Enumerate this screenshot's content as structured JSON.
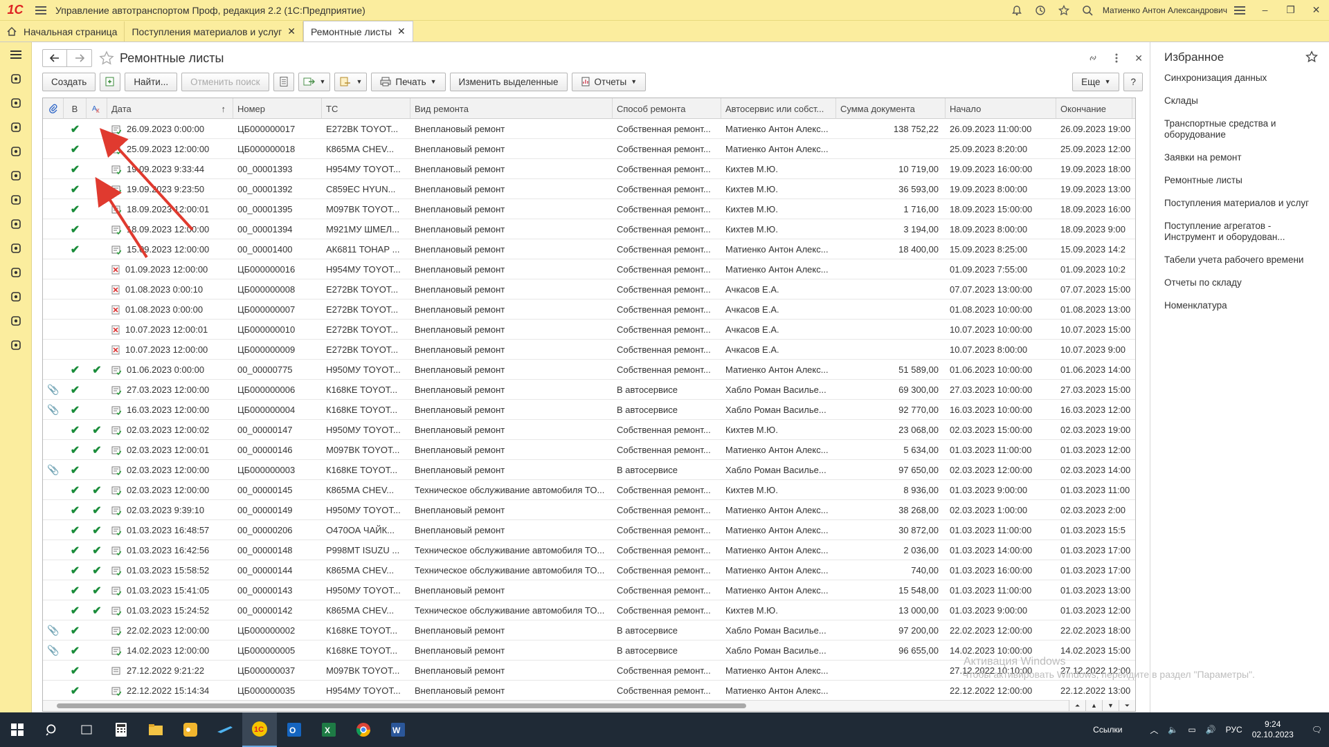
{
  "app": {
    "logo_text": "1С",
    "title": "Управление автотранспортом Проф, редакция 2.2  (1С:Предприятие)",
    "user": "Матиенко Антон Александрович"
  },
  "tabs": [
    {
      "label": "Начальная страница",
      "active": false,
      "closable": false
    },
    {
      "label": "Поступления материалов и услуг",
      "active": false,
      "closable": true
    },
    {
      "label": "Ремонтные листы",
      "active": true,
      "closable": true
    }
  ],
  "sidebar_icons": [
    "menu-icon",
    "wrench-icon",
    "truck-icon",
    "warehouse-icon",
    "employees-icon",
    "fuel-icon",
    "calculator-icon",
    "repair-icon",
    "tire-icon",
    "finance-icon",
    "reports-icon",
    "documents-icon",
    "settings-icon"
  ],
  "form": {
    "title": "Ремонтные листы"
  },
  "toolbar": {
    "create": "Создать",
    "find": "Найти...",
    "cancel_search": "Отменить поиск",
    "print": "Печать",
    "change_selected": "Изменить выделенные",
    "reports": "Отчеты",
    "more": "Еще",
    "help": "?"
  },
  "grid": {
    "headers": {
      "v": "В",
      "date": "Дата",
      "number": "Номер",
      "ts": "ТС",
      "repair_type": "Вид ремонта",
      "repair_method": "Способ ремонта",
      "autoservice": "Автосервис или собст...",
      "amount": "Сумма документа",
      "start": "Начало",
      "end": "Окончание"
    },
    "rows": [
      {
        "clip": "",
        "v": "✔",
        "b": "",
        "date": "26.09.2023 0:00:00",
        "num": "ЦБ000000017",
        "ts": "Е272ВК TOYOT...",
        "type": "Внеплановый ремонт",
        "method": "Собственная ремонт...",
        "service": "Матиенко Антон Алекс...",
        "amount": "138 752,22",
        "start": "26.09.2023 11:00:00",
        "end": "26.09.2023 19:00",
        "status": "posted"
      },
      {
        "clip": "",
        "v": "✔",
        "b": "",
        "date": "25.09.2023 12:00:00",
        "num": "ЦБ000000018",
        "ts": "К865МА CHEV...",
        "type": "Внеплановый ремонт",
        "method": "Собственная ремонт...",
        "service": "Матиенко Антон Алекс...",
        "amount": "",
        "start": "25.09.2023 8:20:00",
        "end": "25.09.2023 12:00",
        "status": "posted"
      },
      {
        "clip": "",
        "v": "✔",
        "b": "",
        "date": "19.09.2023 9:33:44",
        "num": "00_00001393",
        "ts": "Н954МУ TOYOT...",
        "type": "Внеплановый ремонт",
        "method": "Собственная ремонт...",
        "service": "Кихтев М.Ю.",
        "amount": "10 719,00",
        "start": "19.09.2023 16:00:00",
        "end": "19.09.2023 18:00",
        "status": "posted"
      },
      {
        "clip": "",
        "v": "✔",
        "b": "",
        "date": "19.09.2023 9:23:50",
        "num": "00_00001392",
        "ts": "С859ЕС HYUN...",
        "type": "Внеплановый ремонт",
        "method": "Собственная ремонт...",
        "service": "Кихтев М.Ю.",
        "amount": "36 593,00",
        "start": "19.09.2023 8:00:00",
        "end": "19.09.2023 13:00",
        "status": "posted"
      },
      {
        "clip": "",
        "v": "✔",
        "b": "",
        "date": "18.09.2023 12:00:01",
        "num": "00_00001395",
        "ts": "М097ВК TOYOT...",
        "type": "Внеплановый ремонт",
        "method": "Собственная ремонт...",
        "service": "Кихтев М.Ю.",
        "amount": "1 716,00",
        "start": "18.09.2023 15:00:00",
        "end": "18.09.2023 16:00",
        "status": "posted"
      },
      {
        "clip": "",
        "v": "✔",
        "b": "",
        "date": "18.09.2023 12:00:00",
        "num": "00_00001394",
        "ts": "М921МУ ШМЕЛ...",
        "type": "Внеплановый ремонт",
        "method": "Собственная ремонт...",
        "service": "Кихтев М.Ю.",
        "amount": "3 194,00",
        "start": "18.09.2023 8:00:00",
        "end": "18.09.2023 9:00",
        "status": "posted"
      },
      {
        "clip": "",
        "v": "✔",
        "b": "",
        "date": "15.09.2023 12:00:00",
        "num": "00_00001400",
        "ts": "АК6811 ТОНАР ...",
        "type": "Внеплановый ремонт",
        "method": "Собственная ремонт...",
        "service": "Матиенко Антон Алекс...",
        "amount": "18 400,00",
        "start": "15.09.2023 8:25:00",
        "end": "15.09.2023 14:2",
        "status": "posted"
      },
      {
        "clip": "",
        "v": "",
        "b": "",
        "date": "01.09.2023 12:00:00",
        "num": "ЦБ000000016",
        "ts": "Н954МУ TOYOT...",
        "type": "Внеплановый ремонт",
        "method": "Собственная ремонт...",
        "service": "Матиенко Антон Алекс...",
        "amount": "",
        "start": "01.09.2023 7:55:00",
        "end": "01.09.2023 10:2",
        "status": "deleted"
      },
      {
        "clip": "",
        "v": "",
        "b": "",
        "date": "01.08.2023 0:00:10",
        "num": "ЦБ000000008",
        "ts": "Е272ВК TOYOT...",
        "type": "Внеплановый ремонт",
        "method": "Собственная ремонт...",
        "service": "Ачкасов Е.А.",
        "amount": "",
        "start": "07.07.2023 13:00:00",
        "end": "07.07.2023 15:00",
        "status": "deleted"
      },
      {
        "clip": "",
        "v": "",
        "b": "",
        "date": "01.08.2023 0:00:00",
        "num": "ЦБ000000007",
        "ts": "Е272ВК TOYOT...",
        "type": "Внеплановый ремонт",
        "method": "Собственная ремонт...",
        "service": "Ачкасов Е.А.",
        "amount": "",
        "start": "01.08.2023 10:00:00",
        "end": "01.08.2023 13:00",
        "status": "deleted"
      },
      {
        "clip": "",
        "v": "",
        "b": "",
        "date": "10.07.2023 12:00:01",
        "num": "ЦБ000000010",
        "ts": "Е272ВК TOYOT...",
        "type": "Внеплановый ремонт",
        "method": "Собственная ремонт...",
        "service": "Ачкасов Е.А.",
        "amount": "",
        "start": "10.07.2023 10:00:00",
        "end": "10.07.2023 15:00",
        "status": "deleted"
      },
      {
        "clip": "",
        "v": "",
        "b": "",
        "date": "10.07.2023 12:00:00",
        "num": "ЦБ000000009",
        "ts": "Е272ВК TOYOT...",
        "type": "Внеплановый ремонт",
        "method": "Собственная ремонт...",
        "service": "Ачкасов Е.А.",
        "amount": "",
        "start": "10.07.2023 8:00:00",
        "end": "10.07.2023 9:00",
        "status": "deleted"
      },
      {
        "clip": "",
        "v": "✔",
        "b": "✔",
        "date": "01.06.2023 0:00:00",
        "num": "00_00000775",
        "ts": "Н950МУ TOYOT...",
        "type": "Внеплановый ремонт",
        "method": "Собственная ремонт...",
        "service": "Матиенко Антон Алекс...",
        "amount": "51 589,00",
        "start": "01.06.2023 10:00:00",
        "end": "01.06.2023 14:00",
        "status": "posted"
      },
      {
        "clip": "📎",
        "v": "✔",
        "b": "",
        "date": "27.03.2023 12:00:00",
        "num": "ЦБ000000006",
        "ts": "К168КЕ TOYOT...",
        "type": "Внеплановый ремонт",
        "method": "В автосервисе",
        "service": "Хабло Роман Василье...",
        "amount": "69 300,00",
        "start": "27.03.2023 10:00:00",
        "end": "27.03.2023 15:00",
        "status": "posted"
      },
      {
        "clip": "📎",
        "v": "✔",
        "b": "",
        "date": "16.03.2023 12:00:00",
        "num": "ЦБ000000004",
        "ts": "К168КЕ TOYOT...",
        "type": "Внеплановый ремонт",
        "method": "В автосервисе",
        "service": "Хабло Роман Василье...",
        "amount": "92 770,00",
        "start": "16.03.2023 10:00:00",
        "end": "16.03.2023 12:00",
        "status": "posted"
      },
      {
        "clip": "",
        "v": "✔",
        "b": "✔",
        "date": "02.03.2023 12:00:02",
        "num": "00_00000147",
        "ts": "Н950МУ TOYOT...",
        "type": "Внеплановый ремонт",
        "method": "Собственная ремонт...",
        "service": "Кихтев М.Ю.",
        "amount": "23 068,00",
        "start": "02.03.2023 15:00:00",
        "end": "02.03.2023 19:00",
        "status": "posted"
      },
      {
        "clip": "",
        "v": "✔",
        "b": "✔",
        "date": "02.03.2023 12:00:01",
        "num": "00_00000146",
        "ts": "М097ВК TOYOT...",
        "type": "Внеплановый ремонт",
        "method": "Собственная ремонт...",
        "service": "Матиенко Антон Алекс...",
        "amount": "5 634,00",
        "start": "01.03.2023 11:00:00",
        "end": "01.03.2023 12:00",
        "status": "posted"
      },
      {
        "clip": "📎",
        "v": "✔",
        "b": "",
        "date": "02.03.2023 12:00:00",
        "num": "ЦБ000000003",
        "ts": "К168КЕ TOYOT...",
        "type": "Внеплановый ремонт",
        "method": "В автосервисе",
        "service": "Хабло Роман Василье...",
        "amount": "97 650,00",
        "start": "02.03.2023 12:00:00",
        "end": "02.03.2023 14:00",
        "status": "posted"
      },
      {
        "clip": "",
        "v": "✔",
        "b": "✔",
        "date": "02.03.2023 12:00:00",
        "num": "00_00000145",
        "ts": "К865МА CHEV...",
        "type": "Техническое обслуживание автомобиля ТО...",
        "method": "Собственная ремонт...",
        "service": "Кихтев М.Ю.",
        "amount": "8 936,00",
        "start": "01.03.2023 9:00:00",
        "end": "01.03.2023 11:00",
        "status": "posted"
      },
      {
        "clip": "",
        "v": "✔",
        "b": "✔",
        "date": "02.03.2023 9:39:10",
        "num": "00_00000149",
        "ts": "Н950МУ TOYOT...",
        "type": "Внеплановый ремонт",
        "method": "Собственная ремонт...",
        "service": "Матиенко Антон Алекс...",
        "amount": "38 268,00",
        "start": "02.03.2023 1:00:00",
        "end": "02.03.2023 2:00",
        "status": "posted"
      },
      {
        "clip": "",
        "v": "✔",
        "b": "✔",
        "date": "01.03.2023 16:48:57",
        "num": "00_00000206",
        "ts": "О470ОА ЧАЙК...",
        "type": "Внеплановый ремонт",
        "method": "Собственная ремонт...",
        "service": "Матиенко Антон Алекс...",
        "amount": "30 872,00",
        "start": "01.03.2023 11:00:00",
        "end": "01.03.2023 15:5",
        "status": "posted"
      },
      {
        "clip": "",
        "v": "✔",
        "b": "✔",
        "date": "01.03.2023 16:42:56",
        "num": "00_00000148",
        "ts": "Р998МТ ISUZU ...",
        "type": "Техническое обслуживание автомобиля ТО...",
        "method": "Собственная ремонт...",
        "service": "Матиенко Антон Алекс...",
        "amount": "2 036,00",
        "start": "01.03.2023 14:00:00",
        "end": "01.03.2023 17:00",
        "status": "posted"
      },
      {
        "clip": "",
        "v": "✔",
        "b": "✔",
        "date": "01.03.2023 15:58:52",
        "num": "00_00000144",
        "ts": "К865МА CHEV...",
        "type": "Техническое обслуживание автомобиля ТО...",
        "method": "Собственная ремонт...",
        "service": "Матиенко Антон Алекс...",
        "amount": "740,00",
        "start": "01.03.2023 16:00:00",
        "end": "01.03.2023 17:00",
        "status": "posted"
      },
      {
        "clip": "",
        "v": "✔",
        "b": "✔",
        "date": "01.03.2023 15:41:05",
        "num": "00_00000143",
        "ts": "Н950МУ TOYOT...",
        "type": "Внеплановый ремонт",
        "method": "Собственная ремонт...",
        "service": "Матиенко Антон Алекс...",
        "amount": "15 548,00",
        "start": "01.03.2023 11:00:00",
        "end": "01.03.2023 13:00",
        "status": "posted"
      },
      {
        "clip": "",
        "v": "✔",
        "b": "✔",
        "date": "01.03.2023 15:24:52",
        "num": "00_00000142",
        "ts": "К865МА CHEV...",
        "type": "Техническое обслуживание автомобиля ТО...",
        "method": "Собственная ремонт...",
        "service": "Кихтев М.Ю.",
        "amount": "13 000,00",
        "start": "01.03.2023 9:00:00",
        "end": "01.03.2023 12:00",
        "status": "posted"
      },
      {
        "clip": "📎",
        "v": "✔",
        "b": "",
        "date": "22.02.2023 12:00:00",
        "num": "ЦБ000000002",
        "ts": "К168КЕ TOYOT...",
        "type": "Внеплановый ремонт",
        "method": "В автосервисе",
        "service": "Хабло Роман Василье...",
        "amount": "97 200,00",
        "start": "22.02.2023 12:00:00",
        "end": "22.02.2023 18:00",
        "status": "posted"
      },
      {
        "clip": "📎",
        "v": "✔",
        "b": "",
        "date": "14.02.2023 12:00:00",
        "num": "ЦБ000000005",
        "ts": "К168КЕ TOYOT...",
        "type": "Внеплановый ремонт",
        "method": "В автосервисе",
        "service": "Хабло Роман Василье...",
        "amount": "96 655,00",
        "start": "14.02.2023 10:00:00",
        "end": "14.02.2023 15:00",
        "status": "posted"
      },
      {
        "clip": "",
        "v": "✔",
        "b": "",
        "date": "27.12.2022 9:21:22",
        "num": "ЦБ000000037",
        "ts": "М097ВК TOYOT...",
        "type": "Внеплановый ремонт",
        "method": "Собственная ремонт...",
        "service": "Матиенко Антон Алекс...",
        "amount": "",
        "start": "27.12.2022 10:10:00",
        "end": "27.12.2022 12:00",
        "status": "plain"
      },
      {
        "clip": "",
        "v": "✔",
        "b": "",
        "date": "22.12.2022 15:14:34",
        "num": "ЦБ000000035",
        "ts": "Н954МУ TOYOT...",
        "type": "Внеплановый ремонт",
        "method": "Собственная ремонт...",
        "service": "Матиенко Антон Алекс...",
        "amount": "",
        "start": "22.12.2022 12:00:00",
        "end": "22.12.2022 13:00",
        "status": "posted"
      }
    ]
  },
  "favorites": {
    "title": "Избранное",
    "items": [
      "Синхронизация данных",
      "Склады",
      "Транспортные средства и оборудование",
      "Заявки на ремонт",
      "Ремонтные листы",
      "Поступления материалов и услуг",
      "Поступление агрегатов - Инструмент и оборудован...",
      "Табели учета рабочего времени",
      "Отчеты по складу",
      "Номенклатура"
    ]
  },
  "watermark": {
    "line1": "Активация Windows",
    "line2": "Чтобы активировать Windows, перейдите в раздел \"Параметры\"."
  },
  "taskbar": {
    "links_label": "Ссылки",
    "lang": "РУС",
    "time": "9:24",
    "date": "02.10.2023"
  },
  "colors": {
    "panel_yellow": "#fbed9e",
    "check_green": "#1a8c3a",
    "arrow_red": "#e03a2f",
    "taskbar": "#1f2a36"
  }
}
